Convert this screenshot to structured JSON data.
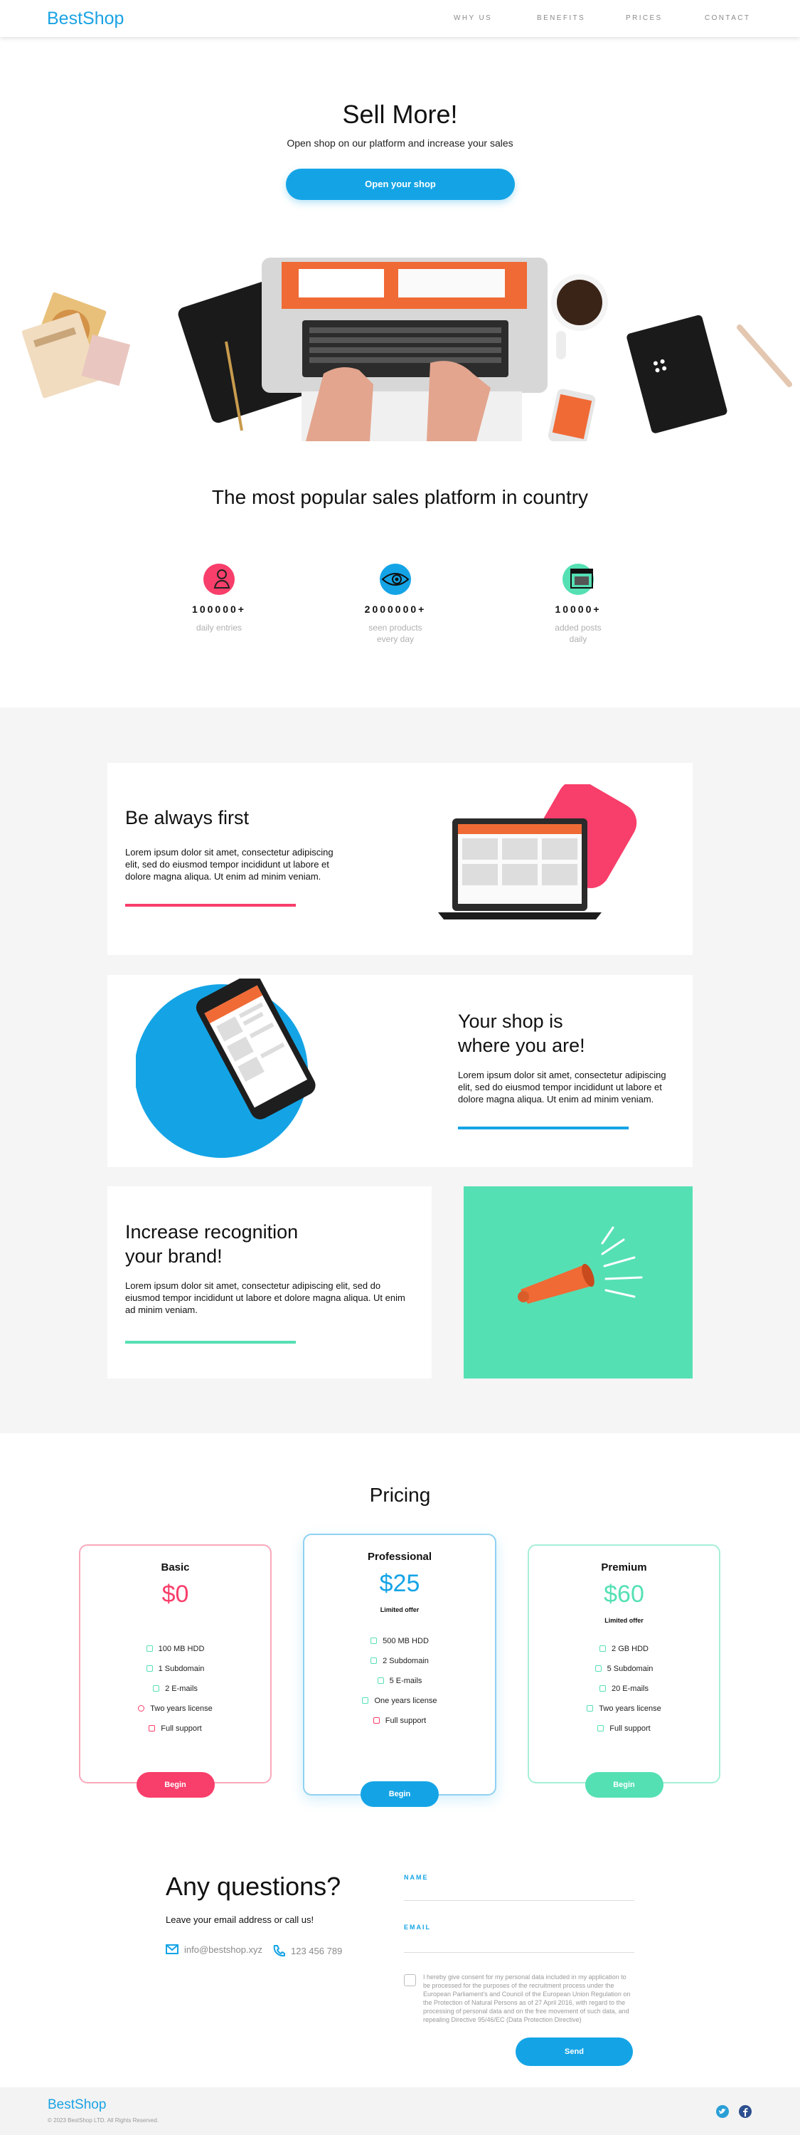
{
  "header": {
    "logo": "BestShop",
    "nav": [
      "WHY US",
      "BENEFITS",
      "PRICES",
      "CONTACT"
    ]
  },
  "hero": {
    "title": "Sell More!",
    "subtitle": "Open shop on our platform and increase your sales",
    "button": "Open your shop"
  },
  "platform": {
    "title": "The most popular sales platform in country",
    "stats": [
      {
        "icon": "user-icon",
        "number": "100000+",
        "label1": "daily entries",
        "label2": ""
      },
      {
        "icon": "eye-icon",
        "number": "2000000+",
        "label1": "seen products",
        "label2": "every day"
      },
      {
        "icon": "window-icon",
        "number": "10000+",
        "label1": "added posts",
        "label2": "daily"
      }
    ]
  },
  "features": [
    {
      "title1": "Be always first",
      "title2": "",
      "text": "Lorem ipsum dolor sit amet, consectetur adipiscing elit, sed do eiusmod tempor incididunt ut labore et dolore magna aliqua. Ut enim ad minim veniam."
    },
    {
      "title1": "Your shop is",
      "title2": "where you are!",
      "text": "Lorem ipsum dolor sit amet, consectetur adipiscing elit, sed do eiusmod tempor incididunt ut labore et dolore magna aliqua. Ut enim ad minim veniam."
    },
    {
      "title1": "Increase recognition",
      "title2": "your brand!",
      "text": "Lorem ipsum dolor sit amet, consectetur adipiscing elit, sed do eiusmod tempor incididunt ut labore et dolore magna aliqua. Ut enim ad minim veniam."
    }
  ],
  "pricing": {
    "title": "Pricing",
    "plans": [
      {
        "name": "Basic",
        "price": "$0",
        "offer": "",
        "features": [
          "100 MB HDD",
          "1 Subdomain",
          "2 E-mails",
          "Two years license",
          "Full support"
        ],
        "button": "Begin"
      },
      {
        "name": "Professional",
        "price": "$25",
        "offer": "Limited offer",
        "features": [
          "500 MB HDD",
          "2 Subdomain",
          "5 E-mails",
          "One years license",
          "Full support"
        ],
        "button": "Begin"
      },
      {
        "name": "Premium",
        "price": "$60",
        "offer": "Limited offer",
        "features": [
          "2 GB HDD",
          "5 Subdomain",
          "20 E-mails",
          "Two years license",
          "Full support"
        ],
        "button": "Begin"
      }
    ]
  },
  "contact": {
    "title": "Any questions?",
    "subtitle": "Leave your email address or call us!",
    "email": "info@bestshop.xyz",
    "phone": "123 456 789",
    "name_label": "NAME",
    "email_label": "EMAIL",
    "consent": "I hereby give consent for my personal data included in my application to be processed for the purposes of the recruitment process under the European Parliament's and Council of the European Union Regulation on the Protection of Natural Persons as of 27 April 2016, with regard to the processing of personal data and on the free movement of such data, and repealing Directive 95/46/EC (Data Protection Directive)",
    "send": "Send"
  },
  "footer": {
    "logo": "BestShop",
    "copyright": "© 2023 BestShop LTD. All Rights Reserved."
  },
  "colors": {
    "blue": "#14a4e6",
    "pink": "#f83e6a",
    "mint": "#55e0b4"
  }
}
